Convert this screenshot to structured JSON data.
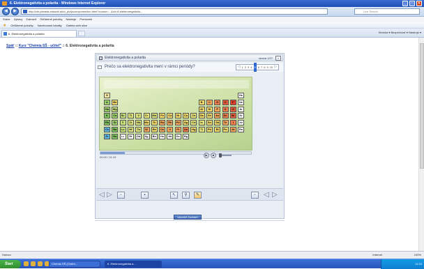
{
  "window": {
    "title": "6. Elektronegativita a polarita - Windows Internet Explorer"
  },
  "browser": {
    "url": "http://cle.planeta.edusoft.sk/cl_plz/jscomp/view/tun.html?course=...&ch=6.elektronegativita...",
    "search_placeholder": "Live Search",
    "menu": [
      "Súbor",
      "Úpravy",
      "Zobraziť",
      "Obľúbené položky",
      "Nástroje",
      "Pomocník"
    ],
    "favorites": [
      "Obľúbené položky",
      "Navrhované lokality",
      "Galéria web slice"
    ],
    "tab_label": "6. Elektronegativita a polarita",
    "command_bar": "Stránka ▾  Bezpečnosť ▾  Nástroje ▾"
  },
  "breadcrumb": {
    "back": "Späť",
    "course": "Kurz \"Chémia SŠ - učiteľ\"",
    "current": " :: 6. Elektronegativita a polarita"
  },
  "panel": {
    "title": "Elektronegativita a polarita",
    "count": "strana 1/27",
    "close": "×",
    "question": "Prečo sa elektronegativita mení v rámci periódy?",
    "pages": [
      "1",
      "2",
      "3",
      "4",
      "5",
      "6",
      "7",
      "8",
      "9",
      "10"
    ],
    "current_page": "5",
    "time": "00:00 / 01:15",
    "progress": 0.16,
    "button": "Ukončiť Zoznam"
  },
  "elements": [
    {
      "s": "H",
      "c": "#f3e8a0"
    },
    {
      "s": "He",
      "c": "#ffffff"
    },
    {
      "s": "Li",
      "c": "#9bd06a"
    },
    {
      "s": "Be",
      "c": "#f0d96a"
    },
    {
      "s": "B",
      "c": "#f0d96a"
    },
    {
      "s": "C",
      "c": "#f2a45a"
    },
    {
      "s": "N",
      "c": "#ee7d4c"
    },
    {
      "s": "O",
      "c": "#e45a3a"
    },
    {
      "s": "F",
      "c": "#e03e2d"
    },
    {
      "s": "Ne",
      "c": "#ffffff"
    },
    {
      "s": "Na",
      "c": "#9bd06a"
    },
    {
      "s": "Mg",
      "c": "#c7df78"
    },
    {
      "s": "Al",
      "c": "#f0d96a"
    },
    {
      "s": "Si",
      "c": "#f0d96a"
    },
    {
      "s": "P",
      "c": "#f2a45a"
    },
    {
      "s": "S",
      "c": "#ee7d4c"
    },
    {
      "s": "Cl",
      "c": "#e45a3a"
    },
    {
      "s": "Ar",
      "c": "#ffffff"
    },
    {
      "s": "K",
      "c": "#7fc45a"
    },
    {
      "s": "Ca",
      "c": "#9bd06a"
    },
    {
      "s": "Sc",
      "c": "#c7df78"
    },
    {
      "s": "Ti",
      "c": "#dde37a"
    },
    {
      "s": "V",
      "c": "#dde37a"
    },
    {
      "s": "Cr",
      "c": "#e8e57a"
    },
    {
      "s": "Mn",
      "c": "#dde37a"
    },
    {
      "s": "Fe",
      "c": "#f0d96a"
    },
    {
      "s": "Co",
      "c": "#f0d96a"
    },
    {
      "s": "Ni",
      "c": "#f0d96a"
    },
    {
      "s": "Cu",
      "c": "#f0d96a"
    },
    {
      "s": "Zn",
      "c": "#e8e57a"
    },
    {
      "s": "Ga",
      "c": "#f0d96a"
    },
    {
      "s": "Ge",
      "c": "#f0d96a"
    },
    {
      "s": "As",
      "c": "#f2a45a"
    },
    {
      "s": "Se",
      "c": "#ee7d4c"
    },
    {
      "s": "Br",
      "c": "#e45a3a"
    },
    {
      "s": "Kr",
      "c": "#ffffff"
    },
    {
      "s": "Rb",
      "c": "#7fc45a"
    },
    {
      "s": "Sr",
      "c": "#9bd06a"
    },
    {
      "s": "Y",
      "c": "#c7df78"
    },
    {
      "s": "Zr",
      "c": "#dde37a"
    },
    {
      "s": "Nb",
      "c": "#dde37a"
    },
    {
      "s": "Mo",
      "c": "#f0d96a"
    },
    {
      "s": "Tc",
      "c": "#f0d96a"
    },
    {
      "s": "Ru",
      "c": "#f2a45a"
    },
    {
      "s": "Rh",
      "c": "#f2a45a"
    },
    {
      "s": "Pd",
      "c": "#f2a45a"
    },
    {
      "s": "Ag",
      "c": "#f0d96a"
    },
    {
      "s": "Cd",
      "c": "#e8e57a"
    },
    {
      "s": "In",
      "c": "#e8e57a"
    },
    {
      "s": "Sn",
      "c": "#f0d96a"
    },
    {
      "s": "Sb",
      "c": "#f0d96a"
    },
    {
      "s": "Te",
      "c": "#f2a45a"
    },
    {
      "s": "I",
      "c": "#ee7d4c"
    },
    {
      "s": "Xe",
      "c": "#ffffff"
    },
    {
      "s": "Cs",
      "c": "#5fb5e0"
    },
    {
      "s": "Ba",
      "c": "#7fc45a"
    },
    {
      "s": "Lu",
      "c": "#c7df78"
    },
    {
      "s": "Hf",
      "c": "#dde37a"
    },
    {
      "s": "Ta",
      "c": "#dde37a"
    },
    {
      "s": "W",
      "c": "#f2a45a"
    },
    {
      "s": "Re",
      "c": "#f0d96a"
    },
    {
      "s": "Os",
      "c": "#f2a45a"
    },
    {
      "s": "Ir",
      "c": "#f2a45a"
    },
    {
      "s": "Pt",
      "c": "#f2a45a"
    },
    {
      "s": "Au",
      "c": "#ee7d4c"
    },
    {
      "s": "Hg",
      "c": "#f0d96a"
    },
    {
      "s": "Tl",
      "c": "#e8e57a"
    },
    {
      "s": "Pb",
      "c": "#f0d96a"
    },
    {
      "s": "Bi",
      "c": "#f0d96a"
    },
    {
      "s": "Po",
      "c": "#f0d96a"
    },
    {
      "s": "At",
      "c": "#f2a45a"
    },
    {
      "s": "Rn",
      "c": "#ffffff"
    },
    {
      "s": "Fr",
      "c": "#5fb5e0"
    },
    {
      "s": "Ra",
      "c": "#7fc45a"
    },
    {
      "s": "Lr",
      "c": "#ffffff"
    },
    {
      "s": "Rf",
      "c": "#ffffff"
    },
    {
      "s": "Db",
      "c": "#ffffff"
    },
    {
      "s": "Sg",
      "c": "#ffffff"
    },
    {
      "s": "Bh",
      "c": "#ffffff"
    },
    {
      "s": "Hs",
      "c": "#ffffff"
    },
    {
      "s": "Mt",
      "c": "#ffffff"
    },
    {
      "s": "Ds",
      "c": "#ffffff"
    },
    {
      "s": "Rg",
      "c": "#ffffff"
    }
  ],
  "status": {
    "left": "Hotovo",
    "zone": "Internet",
    "zoom": "100%"
  },
  "taskbar": {
    "start": "Štart",
    "tasks": [
      "Chémia SŠ (Ondre...",
      "6. Elektronegativita a..."
    ],
    "clock": "11:24"
  }
}
